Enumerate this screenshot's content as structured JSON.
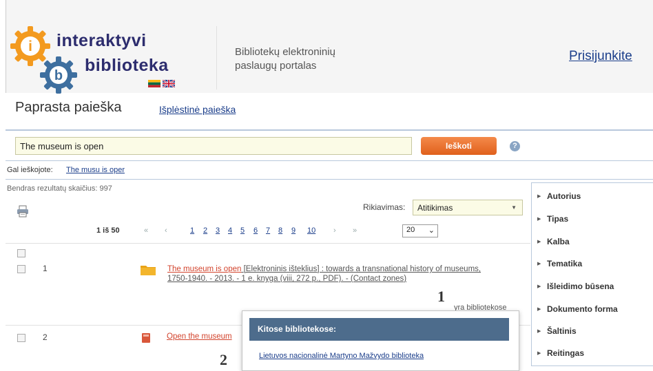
{
  "header": {
    "logo_word1": "interaktyvi",
    "logo_word2": "biblioteka",
    "logo_letter_i": "i",
    "logo_letter_b": "b",
    "portal_title_line1": "Bibliotekų elektroninių",
    "portal_title_line2": "paslaugų portalas",
    "login_label": "Prisijunkite"
  },
  "tabs": {
    "simple": "Paprasta paieška",
    "advanced": "Išplėstinė paieška"
  },
  "search": {
    "value": "The museum is open",
    "button_label": "Ieškoti",
    "help_glyph": "?"
  },
  "suggestion": {
    "label": "Gal ieškojote:",
    "link": "The musu is oper"
  },
  "results_summary": {
    "total_label": "Bendras rezultatų skaičius: 997"
  },
  "sort": {
    "label": "Rikiavimas:",
    "selected": "Atitikimas"
  },
  "pagination": {
    "info": "1 iš 50",
    "first": "«",
    "prev": "‹",
    "pages": [
      "1",
      "2",
      "3",
      "4",
      "5",
      "6",
      "7",
      "8",
      "9",
      "10"
    ],
    "next": "›",
    "last": "»",
    "per_page": "20"
  },
  "results": [
    {
      "number": "1",
      "title": "The museum is open",
      "desc_line1": " [Elektroninis išteklius] : towards a transnational history of museums,",
      "desc_line2": "1750-1940. - 2013. - 1 e. knyga (viii, 272 p., PDF). - (Contact zones)",
      "available": "yra bibliotekose"
    },
    {
      "number": "2",
      "title": "Open the museum"
    }
  ],
  "popup": {
    "header": "Kitose bibliotekose:",
    "library": "Lietuvos nacionalinė Martyno Mažvydo biblioteka"
  },
  "markers": {
    "one": "1",
    "two": "2"
  },
  "facets": [
    "Autorius",
    "Tipas",
    "Kalba",
    "Tematika",
    "Išleidimo būsena",
    "Dokumento forma",
    "Šaltinis",
    "Reitingas"
  ],
  "colors": {
    "accent_orange": "#e0601c",
    "link_blue": "#1a3d8a",
    "title_red": "#d2432c",
    "popup_header": "#4d6c8c"
  }
}
